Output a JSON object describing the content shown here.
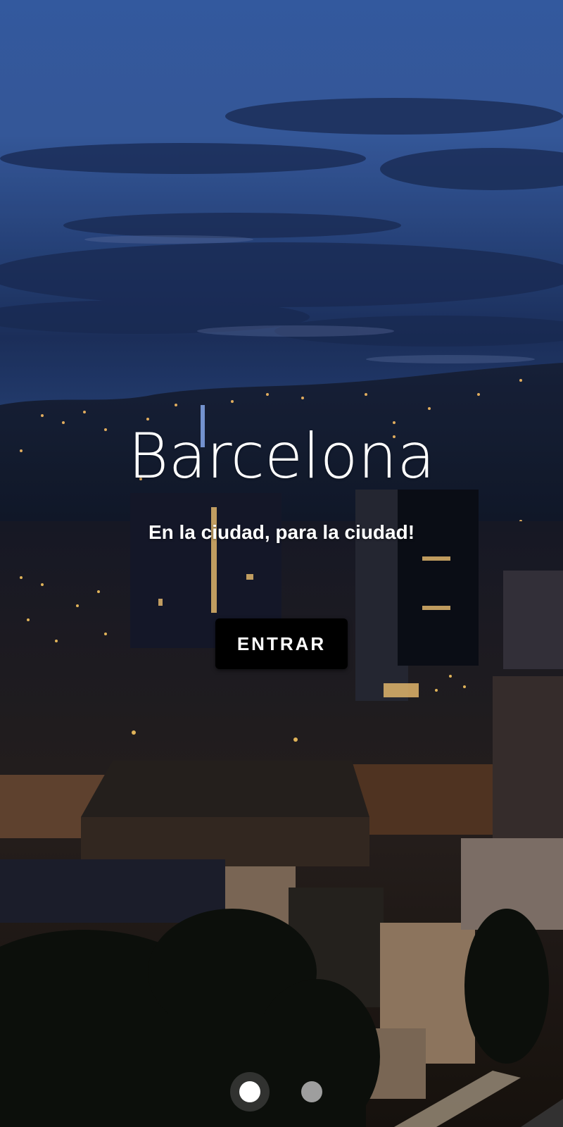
{
  "hero": {
    "title": "Barcelona",
    "subtitle": "En la ciudad, para la ciudad!"
  },
  "actions": {
    "enter_label": "ENTRAR"
  },
  "pager": {
    "page_count": 2,
    "active_index": 0
  },
  "colors": {
    "button_bg": "#000000",
    "text": "#ffffff",
    "dot_active": "#ffffff",
    "dot_inactive": "#9e9e9e"
  }
}
